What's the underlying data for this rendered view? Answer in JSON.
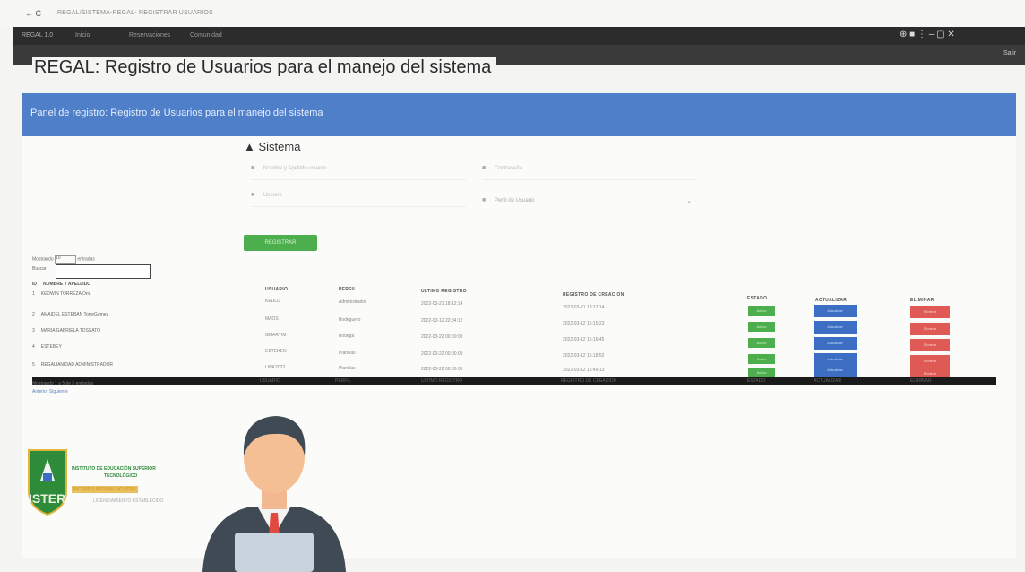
{
  "browser": {
    "nav_symbols": "← C",
    "url": "REGAL/SISTEMA-REGAL- REGISTRAR USUARIOS",
    "controls": "⊕ ■ ⋮   –   ▢   ✕"
  },
  "navbar": {
    "brand": "REGAL 1.0",
    "links": [
      "Inicio",
      "Reservaciones",
      "Comunidad"
    ],
    "logout": "Salir"
  },
  "page": {
    "title": "REGAL: Registro de Usuarios para el manejo del sistema"
  },
  "panel": {
    "heading": "Panel de registro: Registro de Usuarios para el manejo del sistema",
    "section": "Sistema",
    "fields": {
      "nombre": "Nombre y Apellido usuario",
      "contrasena": "Contraseña",
      "usuario": "Usuario",
      "perfil": "Perfil de Usuario"
    },
    "register_button": "REGISTRAR"
  },
  "left_table": {
    "show_label": "Mostrando",
    "show_value": "10",
    "show_suffix": "entradas",
    "search_label": "Buscar:",
    "col_num": "ID",
    "col_name": "NOMBRE Y APELLIDO",
    "rows": [
      {
        "n": "1",
        "name": "KEDWIN TORREZA Oria"
      },
      {
        "n": "2",
        "name": "AMAIDEL ESTEBAN TorreGomez"
      },
      {
        "n": "3",
        "name": "MARIA GABRIELA TOSSATO"
      },
      {
        "n": "4",
        "name": "ESTEBEY"
      },
      {
        "n": "5",
        "name": "REGALIANIDAD ADMINISTRADOR"
      }
    ],
    "footer_info": "Mostrando 1 a 5 de 5 entradas",
    "pagination": "Anterior  Siguiente"
  },
  "main_table": {
    "headers": {
      "usuario": "USUARIO",
      "perfil": "PERFIL",
      "ultimo": "ULTIMO REGISTRO",
      "creacion": "REGISTRO DE CREACION",
      "estado": "ESTADO",
      "actualizar": "ACTUALIZAR",
      "eliminar": "ELIMINAR"
    },
    "rows": [
      {
        "usuario": "KEDLD",
        "perfil": "Administrador",
        "ultimo": "2022-03-21 18:12:14",
        "creacion": "2022-03-21 18:12:14",
        "estado": "Activo",
        "actualizar": "Actualizar",
        "eliminar": "Eliminar"
      },
      {
        "usuario": "MAOS",
        "perfil": "Bodeguero",
        "ultimo": "2022-03-12 22:04:12",
        "creacion": "2022-03-12 15:15:23",
        "estado": "Activo",
        "actualizar": "Actualizar",
        "eliminar": "Eliminar"
      },
      {
        "usuario": "GMARTIM",
        "perfil": "Bodega",
        "ultimo": "2022-03-22 00:00:00",
        "creacion": "2022-03-12 15:16:45",
        "estado": "Activo",
        "actualizar": "Actualizar",
        "eliminar": "Eliminar"
      },
      {
        "usuario": "ESTEHEN",
        "perfil": "Planillas",
        "ultimo": "2022-03-22 00:00:00",
        "creacion": "2022-03-12 15:18:52",
        "estado": "Activo",
        "actualizar": "Actualizar",
        "eliminar": "Eliminar"
      },
      {
        "usuario": "LINK2022",
        "perfil": "Planillas",
        "ultimo": "2022-03-22 00:00:00",
        "creacion": "2022-03-12 15:49:13",
        "estado": "Activo",
        "actualizar": "Actualizar",
        "eliminar": "Eliminar"
      }
    ],
    "footer": {
      "usuario": "USUARIO",
      "perfil": "PERFIL",
      "ultimo": "ULTIMO REGISTRO",
      "creacion": "REGISTRO DE CREACION",
      "estado": "ESTADO",
      "actualizar": "ACTUALIZAR",
      "eliminar": "ELIMINAR"
    }
  },
  "institution": {
    "logo_text": "ISTER",
    "line1": "INSTITUTO DE EDUCACIÓN SUPERIOR",
    "line2": "TECNOLÓGICO",
    "line3": "RICARDO REGINALDO VERA",
    "line4": "LICENCIAMIENTO ESTABLECIDO"
  },
  "colors": {
    "panel_blue": "#4f7fc9",
    "green": "#4cae4c",
    "blue_btn": "#3c6fc4",
    "red_btn": "#e05a55",
    "logo_green": "#2e8b3a",
    "logo_yellow": "#e2b43a"
  }
}
